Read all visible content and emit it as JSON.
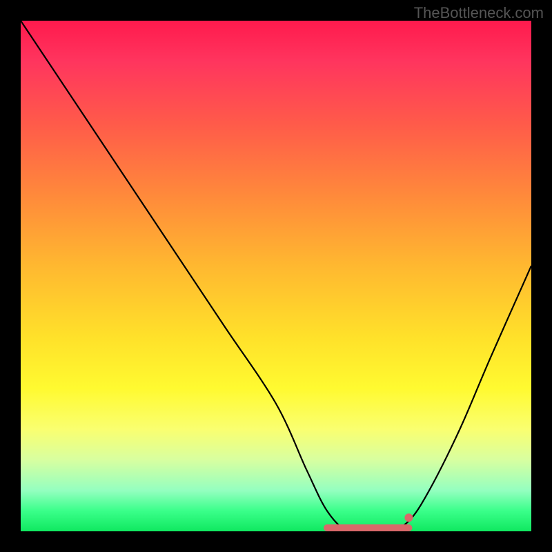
{
  "watermark": "TheBottleneck.com",
  "chart_data": {
    "type": "line",
    "title": "",
    "xlabel": "",
    "ylabel": "",
    "xlim": [
      0,
      100
    ],
    "ylim": [
      0,
      100
    ],
    "series": [
      {
        "name": "curve",
        "x": [
          0,
          10,
          20,
          30,
          40,
          50,
          56,
          60,
          64,
          68,
          72,
          76,
          80,
          86,
          92,
          100
        ],
        "y": [
          100,
          85,
          70,
          55,
          40,
          25,
          12,
          4,
          0,
          0,
          0,
          2,
          8,
          20,
          34,
          52
        ]
      }
    ],
    "optimal_band": {
      "x_start": 60,
      "x_end": 76,
      "y": 0
    },
    "marker_point": {
      "x": 76,
      "y": 2
    }
  }
}
